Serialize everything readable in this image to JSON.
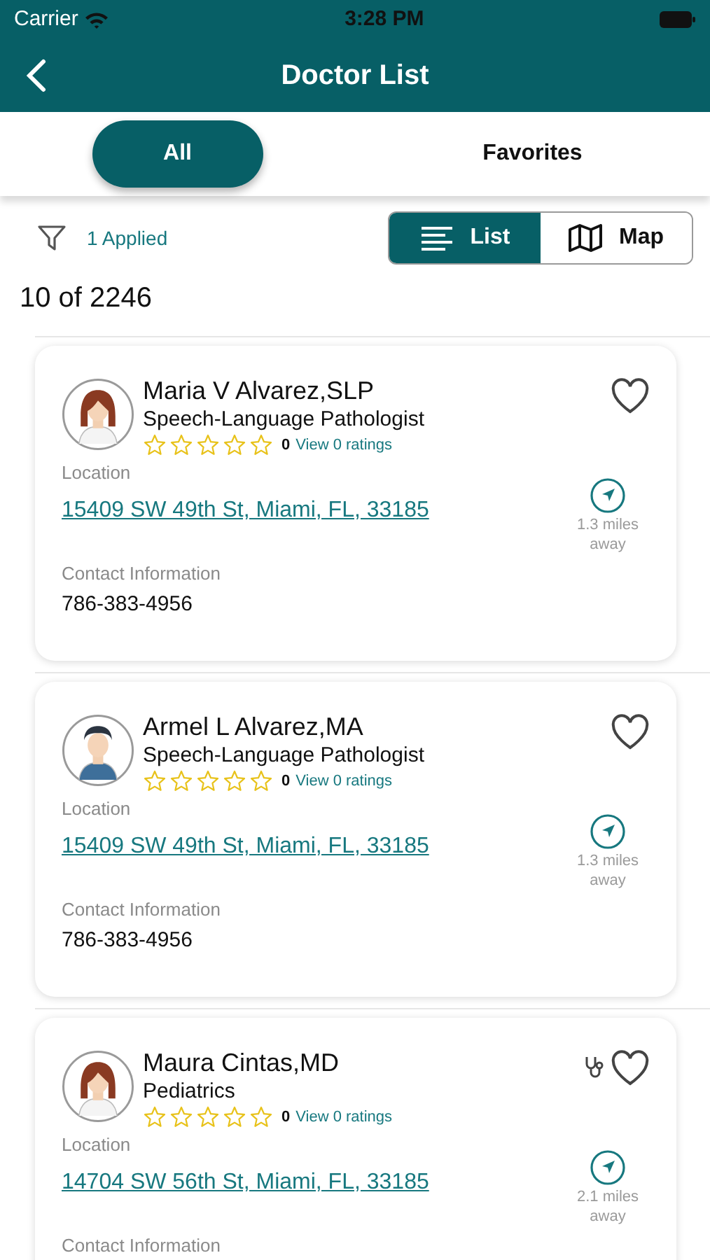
{
  "status_bar": {
    "carrier": "Carrier",
    "time": "3:28 PM"
  },
  "header": {
    "title": "Doctor List"
  },
  "tabs": [
    {
      "label": "All",
      "selected": true
    },
    {
      "label": "Favorites",
      "selected": false
    }
  ],
  "filter": {
    "label": "1 Applied"
  },
  "view_toggle": [
    {
      "label": "List",
      "kind": "list",
      "selected": true
    },
    {
      "label": "Map",
      "kind": "map",
      "selected": false
    }
  ],
  "result_count": "10 of 2246",
  "doctors": [
    {
      "name": "Maria V Alvarez,SLP",
      "specialty": "Speech-Language Pathologist",
      "kind": "female",
      "stars": 0,
      "rating": "0",
      "ratings_link": "View 0 ratings",
      "location_label": "Location",
      "address": "15409 SW 49th St, Miami, FL, 33185",
      "distance": "1.3 miles away",
      "contact_label": "Contact Information",
      "phone": "786-383-4956",
      "stethoscope": false,
      "favorite": false
    },
    {
      "name": "Armel L Alvarez,MA",
      "specialty": "Speech-Language Pathologist",
      "kind": "male",
      "stars": 0,
      "rating": "0",
      "ratings_link": "View 0 ratings",
      "location_label": "Location",
      "address": "15409 SW 49th St, Miami, FL, 33185",
      "distance": "1.3 miles away",
      "contact_label": "Contact Information",
      "phone": "786-383-4956",
      "stethoscope": false,
      "favorite": false
    },
    {
      "name": "Maura Cintas,MD",
      "specialty": "Pediatrics",
      "kind": "female",
      "stars": 0,
      "rating": "0",
      "ratings_link": "View 0 ratings",
      "location_label": "Location",
      "address": "14704 SW 56th St, Miami, FL, 33185",
      "distance": "2.1 miles away",
      "contact_label": "Contact Information",
      "stethoscope": true,
      "favorite": false
    }
  ]
}
